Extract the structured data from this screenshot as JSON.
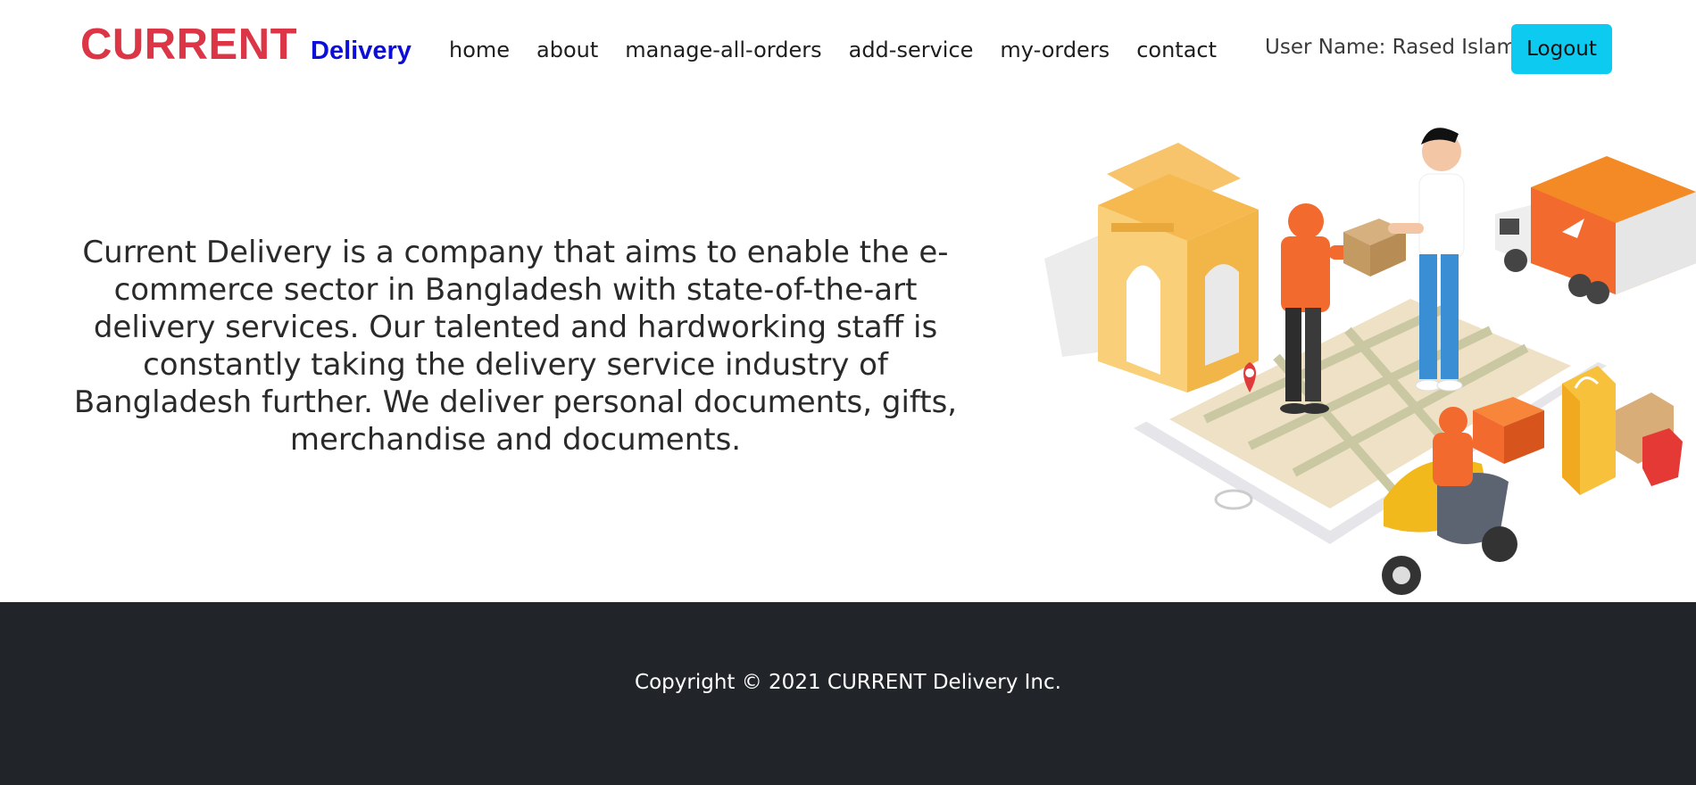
{
  "brand": {
    "main": "CURRENT",
    "sub": "Delivery"
  },
  "nav": [
    {
      "label": "home"
    },
    {
      "label": "about"
    },
    {
      "label": "manage-all-orders"
    },
    {
      "label": "add-service"
    },
    {
      "label": "my-orders"
    },
    {
      "label": "contact"
    }
  ],
  "user": {
    "name_label": "User Name: Rased Islam"
  },
  "logout_label": "Logout",
  "about": {
    "text": "Current Delivery is a company that aims to enable the e-commerce sector in Bangladesh with state-of-the-art delivery services. Our talented and hardworking staff is constantly taking the delivery service industry of Bangladesh further. We deliver personal documents, gifts, merchandise and documents."
  },
  "footer": {
    "copyright": "Copyright © 2021 CURRENT Delivery Inc."
  },
  "colors": {
    "brand_red": "#dc3545",
    "brand_blue": "#0d0dd9",
    "logout_bg": "#0dcaf0",
    "footer_bg": "#212529"
  }
}
